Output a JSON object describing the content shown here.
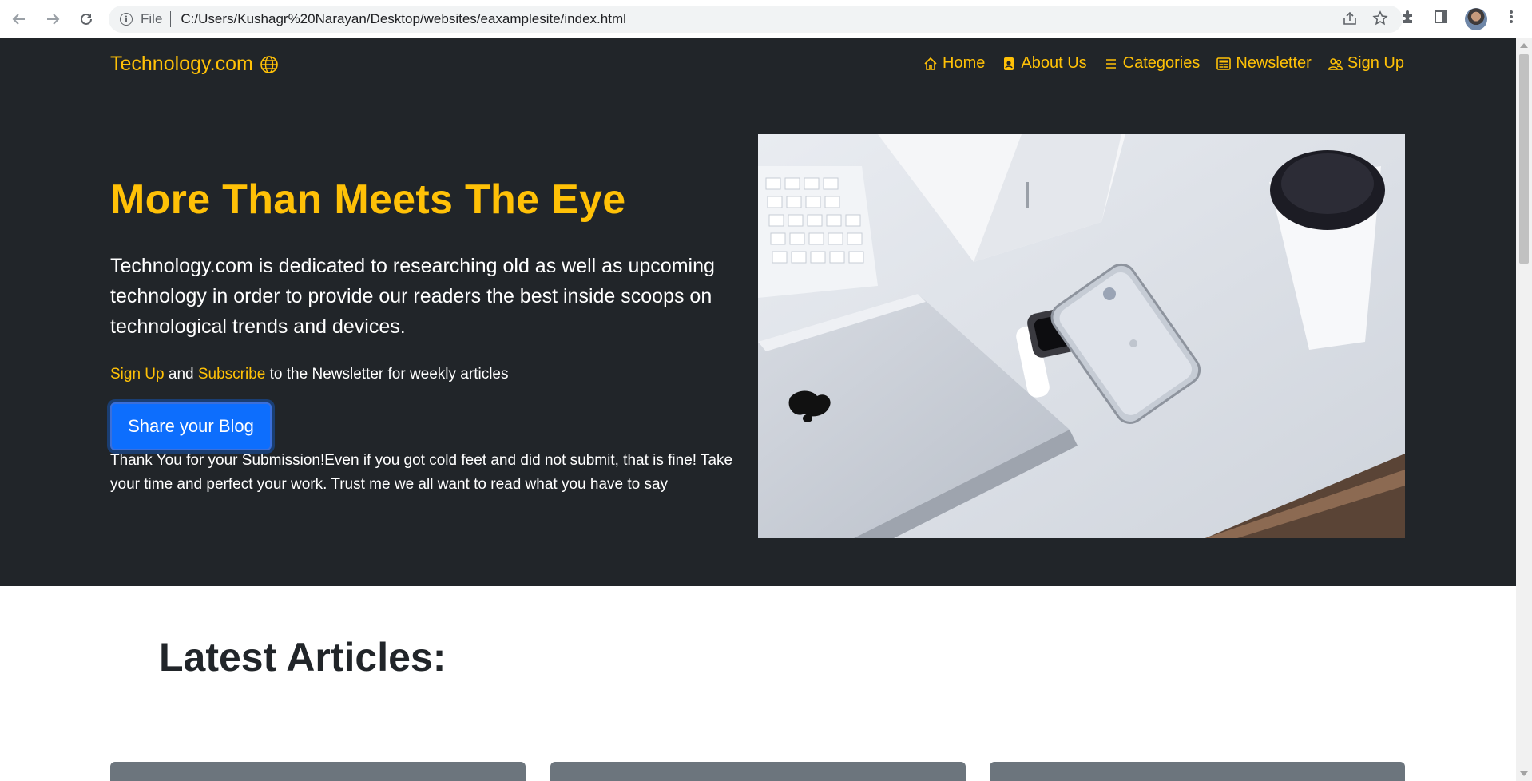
{
  "browser": {
    "file_label": "File",
    "url": "C:/Users/Kushagr%20Narayan/Desktop/websites/eaxamplesite/index.html"
  },
  "site": {
    "brand": "Technology.com",
    "nav": [
      {
        "label": "Home",
        "icon": "house-icon"
      },
      {
        "label": "About Us",
        "icon": "person-badge-icon"
      },
      {
        "label": "Categories",
        "icon": "list-icon"
      },
      {
        "label": "Newsletter",
        "icon": "newspaper-icon"
      },
      {
        "label": "Sign Up",
        "icon": "people-icon"
      }
    ]
  },
  "hero": {
    "title": "More Than Meets The Eye",
    "lead": "Technology.com is dedicated to researching old as well as upcoming technology in order to provide our readers the best inside scoops on technological trends and devices.",
    "sub_signup": "Sign Up",
    "sub_and": " and ",
    "sub_subscribe": "Subscribe",
    "sub_rest": " to the Newsletter for weekly articles",
    "button": "Share your Blog",
    "note": "Thank You for your Submission!Even if you got cold feet and did not submit, that is fine! Take your time and perfect your work. Trust me we all want to read what you have to say"
  },
  "articles": {
    "heading": "Latest Articles:"
  },
  "colors": {
    "accent": "#ffc107",
    "hero_bg": "#212529",
    "button": "#0d6efd",
    "card": "#6c757d"
  }
}
